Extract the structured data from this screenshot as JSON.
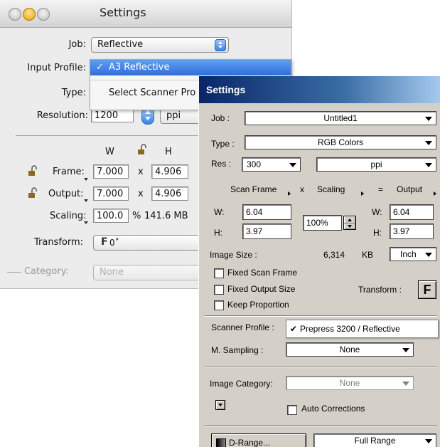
{
  "mac_window": {
    "title": "Settings",
    "job_label": "Job:",
    "job_value": "Reflective",
    "input_profile_label": "Input Profile:",
    "type_label": "Type:",
    "resolution_label": "Resolution:",
    "resolution_value": "1200",
    "resolution_unit": "ppi",
    "col_w": "W",
    "col_h": "H",
    "frame_label": "Frame:",
    "frame_w": "7.000",
    "frame_x": "x",
    "frame_h": "4.906",
    "output_label": "Output:",
    "output_w": "7.000",
    "output_x": "x",
    "output_h": "4.906",
    "scaling_label": "Scaling:",
    "scaling_value": "100.0",
    "scaling_unit": "%",
    "file_size": "141.6 MB",
    "transform_label": "Transform:",
    "transform_value": "0˚",
    "transform_glyph": "F",
    "category_label": "Category:",
    "category_value": "None",
    "profile_menu": {
      "selected_check": "✓",
      "selected": "A3 Reflective",
      "other": "Select Scanner Pro"
    }
  },
  "win_dialog": {
    "title": "Settings",
    "job_label": "Job :",
    "job_value": "Untitled1",
    "type_label": "Type :",
    "type_value": "RGB Colors",
    "res_label": "Res :",
    "res_value": "300",
    "res_unit": "ppi",
    "hdr_scan_frame": "Scan Frame",
    "hdr_x": "x",
    "hdr_scaling": "Scaling",
    "hdr_eq": "=",
    "hdr_output": "Output",
    "w_label": "W:",
    "h_label": "H:",
    "scan_w": "6.04",
    "scan_h": "3.97",
    "scaling_value": "100%",
    "out_w_label": "W:",
    "out_h_label": "H:",
    "out_w": "6.04",
    "out_h": "3.97",
    "image_size_label": "Image Size :",
    "image_size_value": "6,314",
    "image_size_unit": "KB",
    "unit_value": "Inch",
    "fixed_scan_frame": "Fixed Scan Frame",
    "fixed_output_size": "Fixed Output Size",
    "keep_proportion": "Keep Proportion",
    "transform_label": "Transform :",
    "transform_glyph": "F",
    "scanner_profile_label": "Scanner Profile :",
    "scanner_profile_check": "✔",
    "scanner_profile_value": "Prepress 3200 / Reflective",
    "msampling_label": "M. Sampling :",
    "msampling_value": "None",
    "image_category_label": "Image Category:",
    "image_category_value": "None",
    "auto_corrections": "Auto Corrections",
    "drange_button": "D-Range...",
    "full_range_value": "Full Range"
  }
}
